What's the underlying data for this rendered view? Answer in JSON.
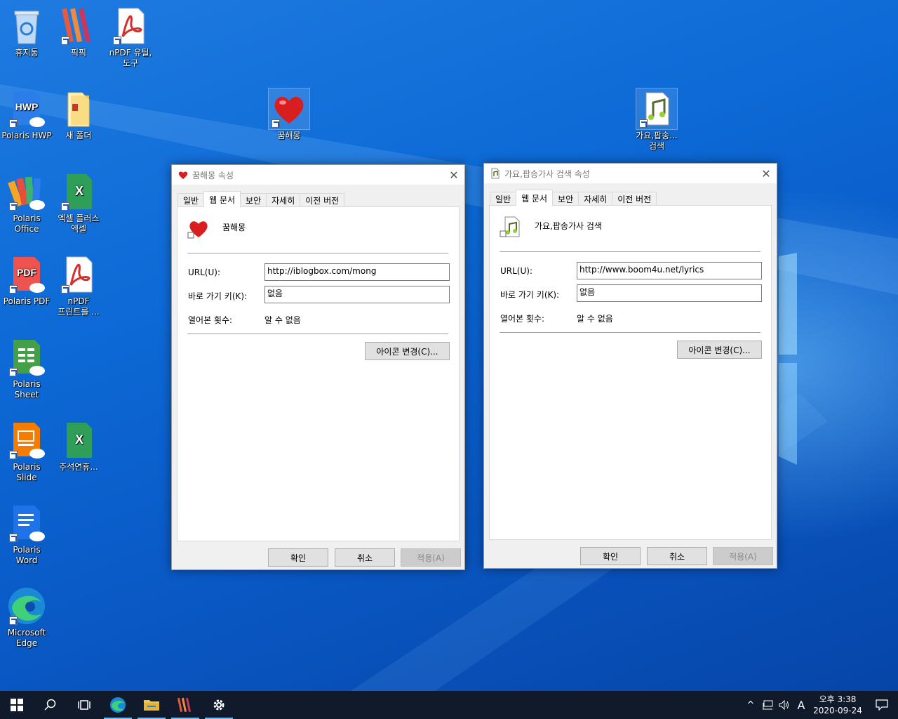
{
  "desktop": {
    "icons": [
      {
        "label": "휴지통"
      },
      {
        "label": "픽픽"
      },
      {
        "label": "nPDF 유틸,도구"
      },
      {
        "label": "Polaris HWP"
      },
      {
        "label": "새 폴더"
      },
      {
        "label": "꿈해몽"
      },
      {
        "label": "가요,팝송... 검색"
      },
      {
        "label": "Polaris Office"
      },
      {
        "label": "엑셀 플러스 엑셀"
      },
      {
        "label": "Polaris PDF"
      },
      {
        "label": "nPDF 프린트를 ..."
      },
      {
        "label": "Polaris Sheet"
      },
      {
        "label": "Polaris Slide"
      },
      {
        "label": "추석연휴..."
      },
      {
        "label": "Polaris Word"
      },
      {
        "label": "Microsoft Edge"
      }
    ],
    "icon_text": {
      "hwp": "HWP",
      "pdf": "PDF",
      "xls": "X"
    }
  },
  "dialog1": {
    "title": "꿈해몽 속성",
    "tabs": [
      "일반",
      "웹 문서",
      "보안",
      "자세히",
      "이전 버전"
    ],
    "name": "꿈해몽",
    "url_label": "URL(U):",
    "url_value": "http://iblogbox.com/mong",
    "shortcut_label": "바로 가기 키(K):",
    "shortcut_value": "없음",
    "visits_label": "열어본 횟수:",
    "visits_value": "알 수 없음",
    "change_icon": "아이콘 변경(C)...",
    "ok": "확인",
    "cancel": "취소",
    "apply": "적용(A)"
  },
  "dialog2": {
    "title": "가요,팝송가사 검색 속성",
    "tabs": [
      "일반",
      "웹 문서",
      "보안",
      "자세히",
      "이전 버전"
    ],
    "name": "가요,팝송가사 검색",
    "url_label": "URL(U):",
    "url_value": "http://www.boom4u.net/lyrics",
    "shortcut_label": "바로 가기 키(K):",
    "shortcut_value": "없음",
    "visits_label": "열어본 횟수:",
    "visits_value": "알 수 없음",
    "change_icon": "아이콘 변경(C)...",
    "ok": "확인",
    "cancel": "취소",
    "apply": "적용(A)"
  },
  "taskbar": {
    "ime": "A",
    "time": "오후 3:38",
    "date": "2020-09-24"
  },
  "colors": {
    "accent": "#0a58c6",
    "taskbar": "#101a2a",
    "heart": "#d81e1e"
  }
}
